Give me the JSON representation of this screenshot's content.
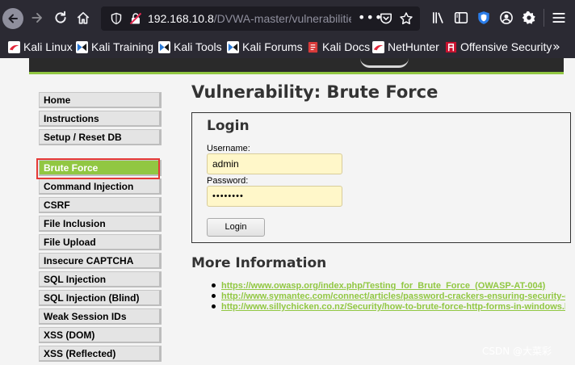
{
  "browser": {
    "url_host": "192.168.10.8",
    "url_path": "/DVWA-master/vulnerabilities/brute/",
    "url_overflow": "•••"
  },
  "bookmarks": [
    {
      "label": "Kali Linux",
      "icon": "kali-icon"
    },
    {
      "label": "Kali Training",
      "icon": "kali-training-icon"
    },
    {
      "label": "Kali Tools",
      "icon": "kali-tools-icon"
    },
    {
      "label": "Kali Forums",
      "icon": "kali-forums-icon"
    },
    {
      "label": "Kali Docs",
      "icon": "kali-docs-icon"
    },
    {
      "label": "NetHunter",
      "icon": "nethunter-icon"
    },
    {
      "label": "Offensive Security",
      "icon": "offsec-icon"
    }
  ],
  "bookmarks_overflow": "»",
  "sidebar": {
    "items": [
      {
        "label": "Home"
      },
      {
        "label": "Instructions"
      },
      {
        "label": "Setup / Reset DB"
      },
      {
        "label": "Brute Force",
        "active": true
      },
      {
        "label": "Command Injection"
      },
      {
        "label": "CSRF"
      },
      {
        "label": "File Inclusion"
      },
      {
        "label": "File Upload"
      },
      {
        "label": "Insecure CAPTCHA"
      },
      {
        "label": "SQL Injection"
      },
      {
        "label": "SQL Injection (Blind)"
      },
      {
        "label": "Weak Session IDs"
      },
      {
        "label": "XSS (DOM)"
      },
      {
        "label": "XSS (Reflected)"
      }
    ]
  },
  "main": {
    "title": "Vulnerability: Brute Force",
    "login": {
      "heading": "Login",
      "username_label": "Username:",
      "username_value": "admin",
      "password_label": "Password:",
      "password_value": "••••••••",
      "button_label": "Login"
    },
    "more_info": {
      "heading": "More Information",
      "links": [
        "https://www.owasp.org/index.php/Testing_for_Brute_Force_(OWASP-AT-004)",
        "http://www.symantec.com/connect/articles/password-crackers-ensuring-security-of-your-password",
        "http://www.sillychicken.co.nz/Security/how-to-brute-force-http-forms-in-windows.html"
      ]
    }
  },
  "watermark": "CSDN @大菜彩",
  "colors": {
    "accent_green": "#91c742",
    "toolbar_bg": "#2b2a33",
    "highlight_red": "#e53935",
    "field_bg": "#fff7c9"
  }
}
